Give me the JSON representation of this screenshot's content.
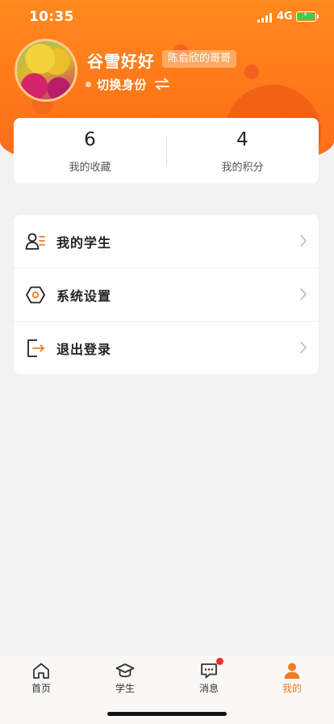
{
  "status_bar": {
    "time": "10:35",
    "network": "4G"
  },
  "profile": {
    "name": "谷雪好好",
    "relation_badge": "陈俞欣的哥哥",
    "switch_label": "切换身份"
  },
  "stats": [
    {
      "value": "6",
      "label": "我的收藏"
    },
    {
      "value": "4",
      "label": "我的积分"
    }
  ],
  "menu": [
    {
      "label": "我的学生",
      "icon": "students-icon"
    },
    {
      "label": "系统设置",
      "icon": "settings-icon"
    },
    {
      "label": "退出登录",
      "icon": "logout-icon"
    }
  ],
  "tabbar": {
    "tabs": [
      {
        "label": "首页",
        "icon": "home-icon"
      },
      {
        "label": "学生",
        "icon": "graduation-cap-icon"
      },
      {
        "label": "消息",
        "icon": "message-icon",
        "badge": true
      },
      {
        "label": "我的",
        "icon": "user-icon",
        "active": true
      }
    ]
  },
  "colors": {
    "accent": "#f07b22",
    "header_gradient_top": "#ff8a1f",
    "header_gradient_bottom": "#fb6d1c",
    "badge_red": "#f0302a",
    "battery_green": "#37d44a"
  }
}
